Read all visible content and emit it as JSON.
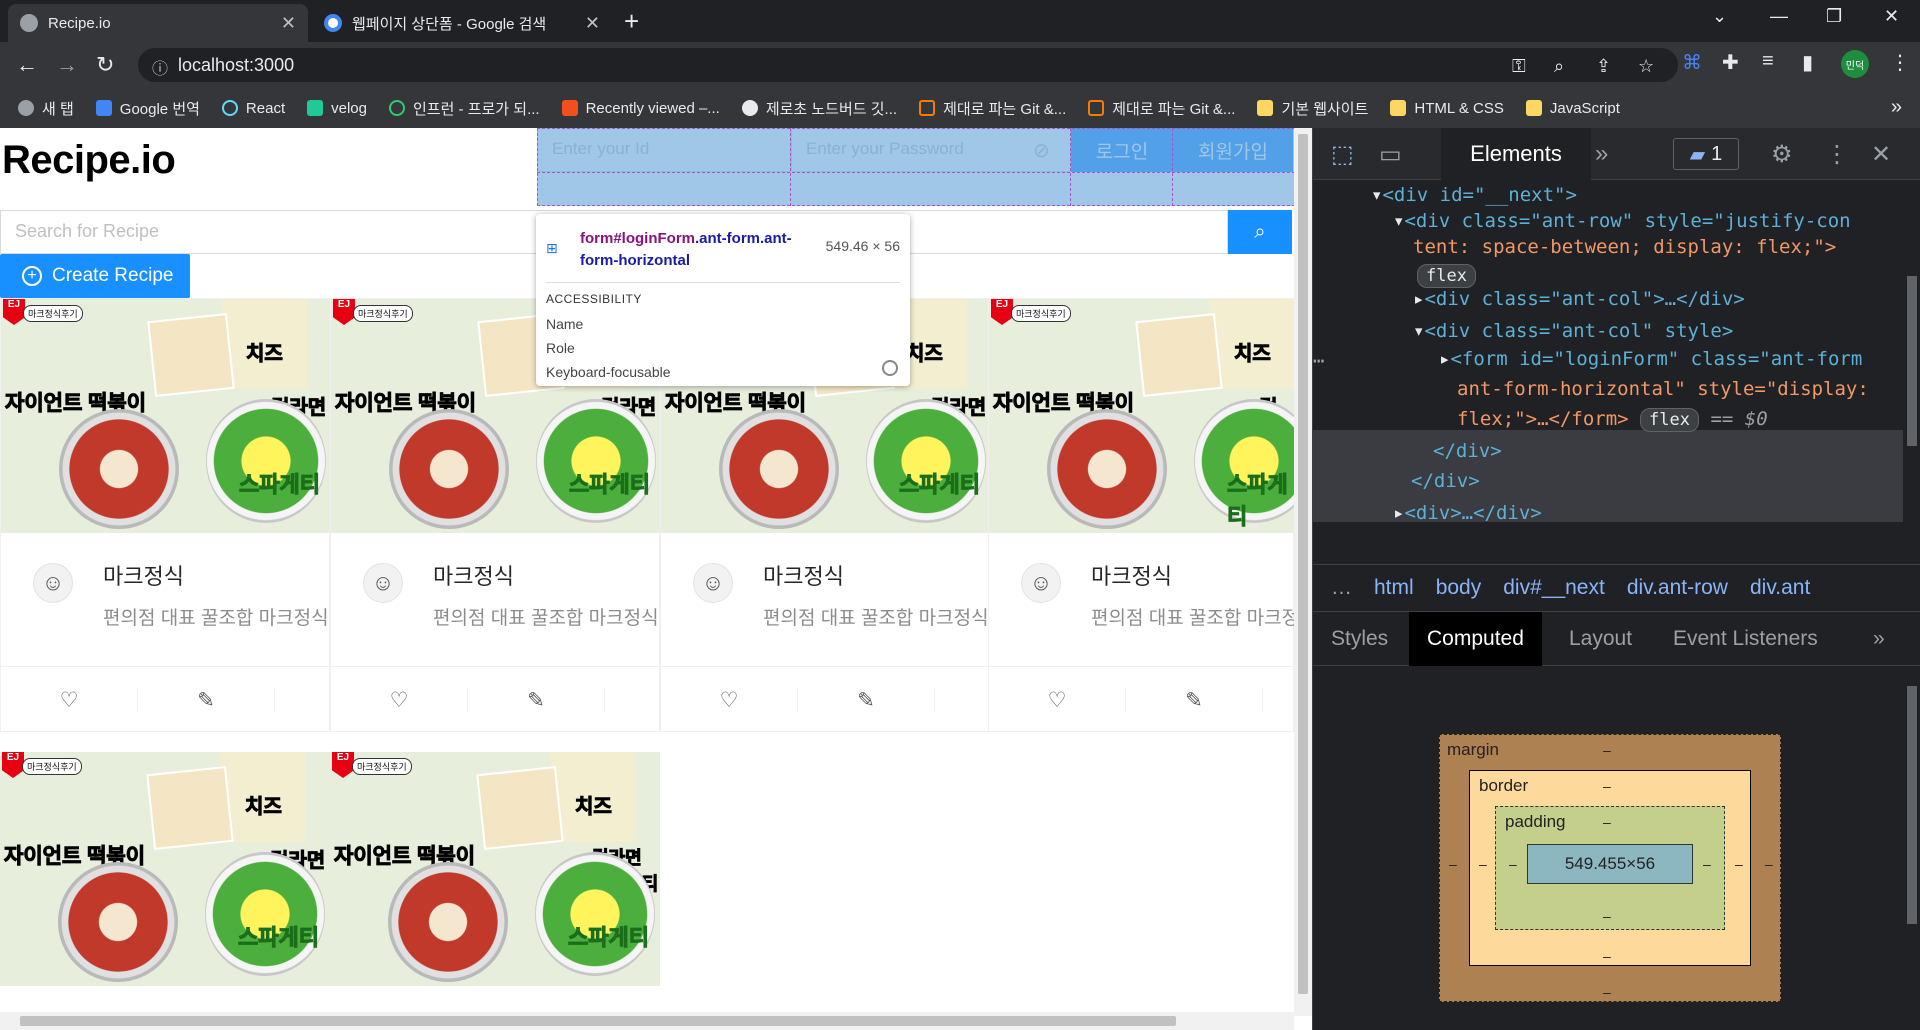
{
  "browser": {
    "tabs": [
      {
        "title": "Recipe.io",
        "active": true
      },
      {
        "title": "웹페이지 상단폼 - Google 검색",
        "active": false
      }
    ],
    "url": "localhost:3000",
    "profile": "민덕",
    "bookmarks": [
      "새 탭",
      "Google 번역",
      "React",
      "velog",
      "인프런 - 프로가 되...",
      "Recently viewed –...",
      "제로초 노드버드 깃...",
      "제대로 파는 Git &...",
      "제대로 파는 Git &...",
      "기본 웹사이트",
      "HTML & CSS",
      "JavaScript"
    ],
    "bookmark_colors": [
      "#9aa0a6",
      "#4285f4",
      "#61dafb",
      "#20c997",
      "#2ecc71",
      "#f24e1e",
      "#e8eaed",
      "#f57c00",
      "#f57c00",
      "#fdd663",
      "#fdd663",
      "#fdd663"
    ]
  },
  "page": {
    "logo": "Recipe.io",
    "login": {
      "id_placeholder": "Enter your Id",
      "password_placeholder": "Enter your Password",
      "login_label": "로그인",
      "signup_label": "회원가입"
    },
    "search": {
      "placeholder": "Search for Recipe"
    },
    "create_label": "Create Recipe",
    "card_image_text": {
      "badge": "EJ",
      "tag": "마크정식후기",
      "cheese": "치즈",
      "left": "자이언트 떡볶이",
      "right": "컵라면",
      "right_long": "컵라면 스파게티",
      "cup": "스파게티"
    },
    "cards": [
      {
        "title": "마크정식",
        "desc": "편의점 대표 꿀조합 마크정식"
      },
      {
        "title": "마크정식",
        "desc": "편의점 대표 꿀조합 마크정식"
      },
      {
        "title": "마크정식",
        "desc": "편의점 대표 꿀조합 마크정식"
      },
      {
        "title": "마크정식",
        "desc": "편의점 대표 꿀조합 마크정식"
      }
    ],
    "inspect_tooltip": {
      "selector_tag": "form#loginForm",
      "selector_class": ".ant-form.ant-form-horizontal",
      "size": "549.46 × 56",
      "section": "ACCESSIBILITY",
      "rows": [
        "Name",
        "Role",
        "Keyboard-focusable"
      ]
    }
  },
  "devtools": {
    "active_tab": "Elements",
    "issues_count": "1",
    "dom_lines": {
      "l1_tag": "<div id=\"__next\">",
      "l2_a": "<div class=\"ant-row\" style=\"justify-con",
      "l2_b": "tent: space-between; display: flex;\">",
      "flex": "flex",
      "l3": "<div class=\"ant-col\">…</div>",
      "l4": "<div class=\"ant-col\" style>",
      "l5_a": "<form id=\"loginForm\" class=\"ant-form",
      "l5_b": "ant-form-horizontal\" style=\"display:",
      "l5_c": "flex;\">…</form>",
      "eq": "== $0",
      "close1": "</div>",
      "close2": "</div>",
      "l8": "<div>…</div>"
    },
    "breadcrumbs": [
      "html",
      "body",
      "div#__next",
      "div.ant-row",
      "div.ant"
    ],
    "subtabs": [
      "Styles",
      "Computed",
      "Layout",
      "Event Listeners"
    ],
    "active_subtab": "Computed",
    "box_model": {
      "margin_label": "margin",
      "border_label": "border",
      "padding_label": "padding",
      "content": "549.455×56",
      "dash": "–"
    }
  }
}
